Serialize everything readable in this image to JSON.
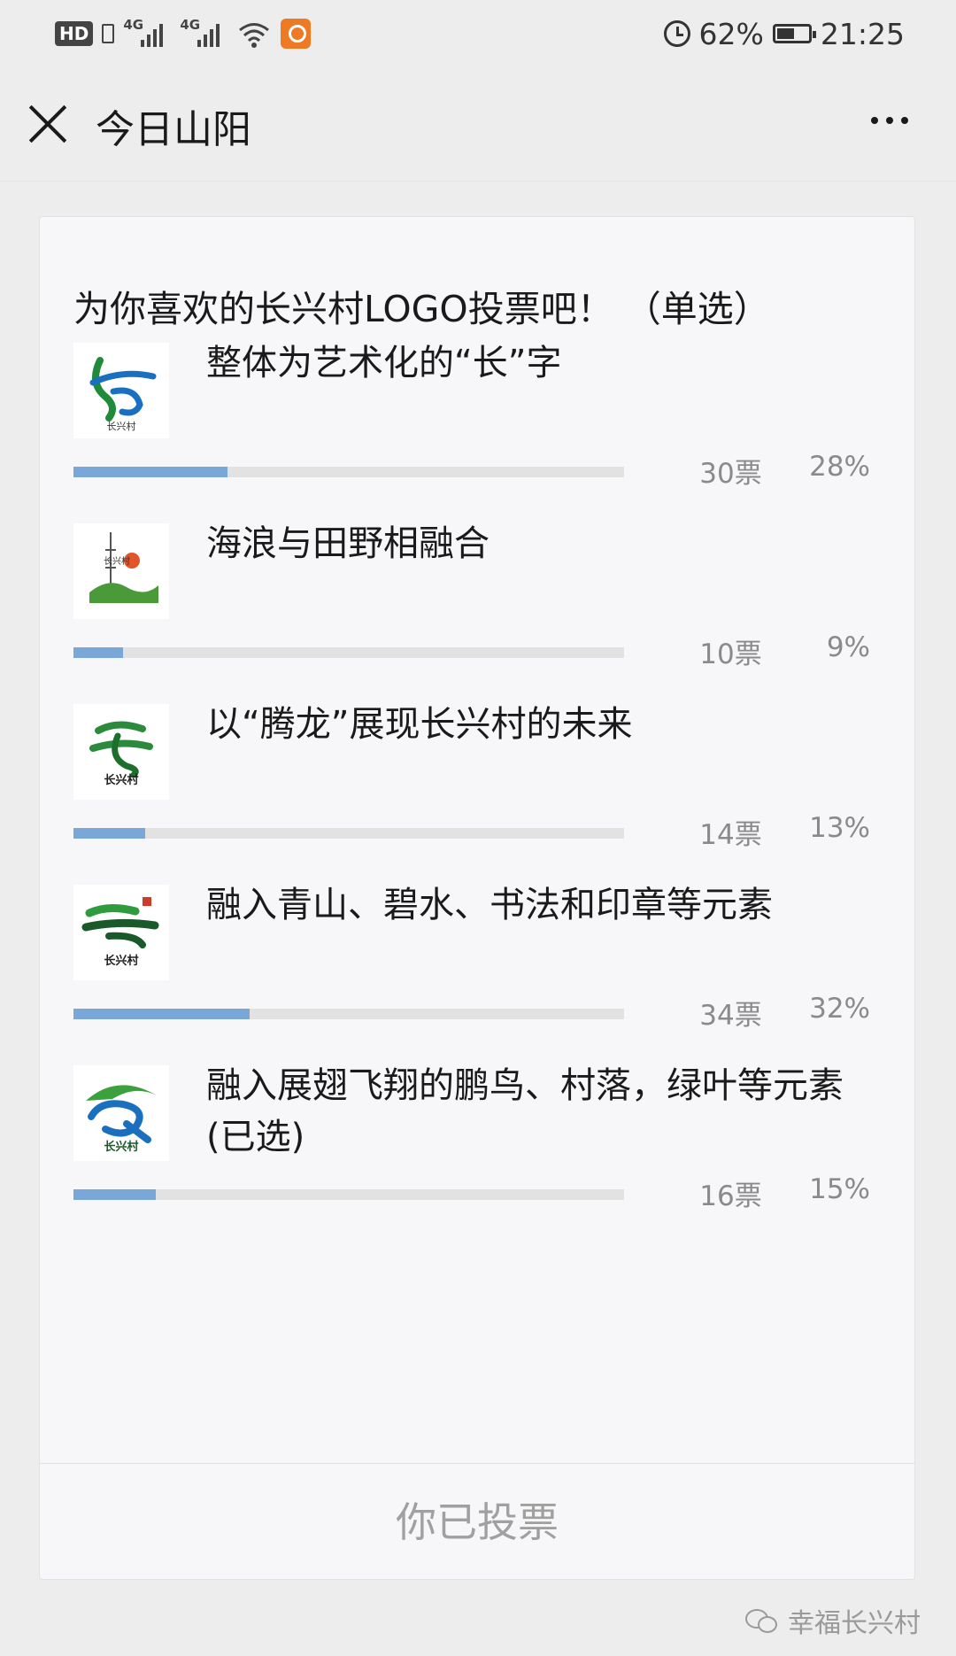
{
  "status_bar": {
    "hd_label": "HD",
    "network_1": "4G",
    "network_2": "4G",
    "battery_percent": "62%",
    "battery_level": 0.62,
    "time": "21:25",
    "icons": [
      "hd-icon",
      "signal-icon",
      "signal-icon",
      "wifi-icon",
      "app-notification-icon",
      "alarm-icon",
      "battery-icon"
    ]
  },
  "nav": {
    "title": "今日山阳",
    "icons": [
      "close-icon",
      "more-icon"
    ]
  },
  "poll": {
    "title": "为你喜欢的长兴村LOGO投票吧！ （单选）",
    "options": [
      {
        "label": "整体为艺术化的“长”字",
        "votes": "30票",
        "percent": "28%",
        "fraction": 0.28,
        "logo_text": "长兴村"
      },
      {
        "label": "海浪与田野相融合",
        "votes": "10票",
        "percent": "9%",
        "fraction": 0.09,
        "logo_text": "长兴村"
      },
      {
        "label": "以“腾龙”展现长兴村的未来",
        "votes": "14票",
        "percent": "13%",
        "fraction": 0.13,
        "logo_text": "长兴村"
      },
      {
        "label": "融入青山、碧水、书法和印章等元素",
        "votes": "34票",
        "percent": "32%",
        "fraction": 0.32,
        "logo_text": "长兴村"
      },
      {
        "label": "融入展翅飞翔的鹏鸟、村落，绿叶等元素 (已选)",
        "votes": "16票",
        "percent": "15%",
        "fraction": 0.15,
        "logo_text": "长兴村"
      }
    ],
    "footer_label": "你已投票"
  },
  "watermark": {
    "text": "幸福长兴村",
    "icon": "wechat-icon"
  },
  "colors": {
    "background": "#ededed",
    "card": "#f7f7f9",
    "bar_fill": "#78a7d8",
    "bar_track": "#e2e2e2",
    "muted_text": "#8a8a8a"
  }
}
